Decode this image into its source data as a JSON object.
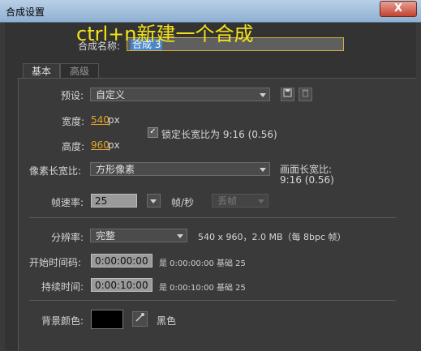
{
  "window": {
    "title": "合成设置",
    "close_glyph": "X"
  },
  "overlay_text": "ctrl+n新建一个合成",
  "comp_name": {
    "label": "合成名称:",
    "value": "合成 3"
  },
  "tabs": [
    {
      "label": "基本"
    },
    {
      "label": "高级"
    }
  ],
  "preset": {
    "label": "预设:",
    "value": "自定义"
  },
  "width": {
    "label": "宽度:",
    "value": "540",
    "unit": "px"
  },
  "height": {
    "label": "高度:",
    "value": "960",
    "unit": "px"
  },
  "lock_aspect": {
    "label": "锁定长宽比为 9:16 (0.56)",
    "checked": true
  },
  "pixel_aspect": {
    "label": "像素长宽比:",
    "value": "方形像素"
  },
  "frame_aspect": {
    "label": "画面长宽比:",
    "value": "9:16 (0.56)"
  },
  "frame_rate": {
    "label": "帧速率:",
    "value": "25",
    "unit": "帧/秒",
    "drop_frame": "丢帧"
  },
  "resolution": {
    "label": "分辨率:",
    "value": "完整",
    "info": "540 x 960，2.0 MB（每 8bpc 帧）"
  },
  "start_timecode": {
    "label": "开始时间码:",
    "value": "0:00:00:00",
    "note": "是 0:00:00:00 基础 25"
  },
  "duration": {
    "label": "持续时间:",
    "value": "0:00:10:00",
    "note": "是 0:00:10:00 基础 25"
  },
  "background": {
    "label": "背景颜色:",
    "color": "#000000",
    "color_name": "黑色"
  },
  "icons": {
    "save_preset": "save-icon",
    "delete_preset": "trash-icon",
    "eyedropper": "eyedropper-icon"
  }
}
